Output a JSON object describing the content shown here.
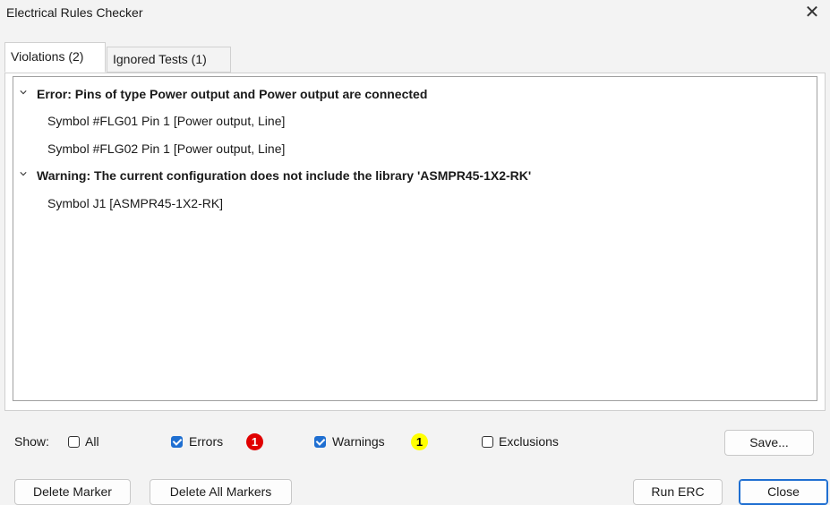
{
  "window": {
    "title": "Electrical Rules Checker",
    "close_glyph": "✕"
  },
  "tabs": [
    {
      "label": "Violations (2)",
      "active": true
    },
    {
      "label": "Ignored Tests (1)",
      "active": false
    }
  ],
  "violations": [
    {
      "label": "Error: Pins of type Power output and Power output are connected",
      "items": [
        "Symbol #FLG01 Pin 1 [Power output, Line]",
        "Symbol #FLG02 Pin 1 [Power output, Line]"
      ]
    },
    {
      "label": "Warning: The current configuration does not include the library 'ASMPR45-1X2-RK'",
      "items": [
        "Symbol J1 [ASMPR45-1X2-RK]"
      ]
    }
  ],
  "filters": {
    "show_label": "Show:",
    "all": {
      "label": "All",
      "checked": false
    },
    "errors": {
      "label": "Errors",
      "checked": true,
      "count": "1"
    },
    "warnings": {
      "label": "Warnings",
      "checked": true,
      "count": "1"
    },
    "exclusions": {
      "label": "Exclusions",
      "checked": false
    }
  },
  "buttons": {
    "save": "Save...",
    "delete_marker": "Delete Marker",
    "delete_all_markers": "Delete All Markers",
    "run_erc": "Run ERC",
    "close": "Close"
  },
  "colors": {
    "error_badge": "#e00000",
    "warning_badge": "#ffff00",
    "checkbox_checked": "#1f6fd1",
    "accent_border": "#1f6fd1"
  }
}
